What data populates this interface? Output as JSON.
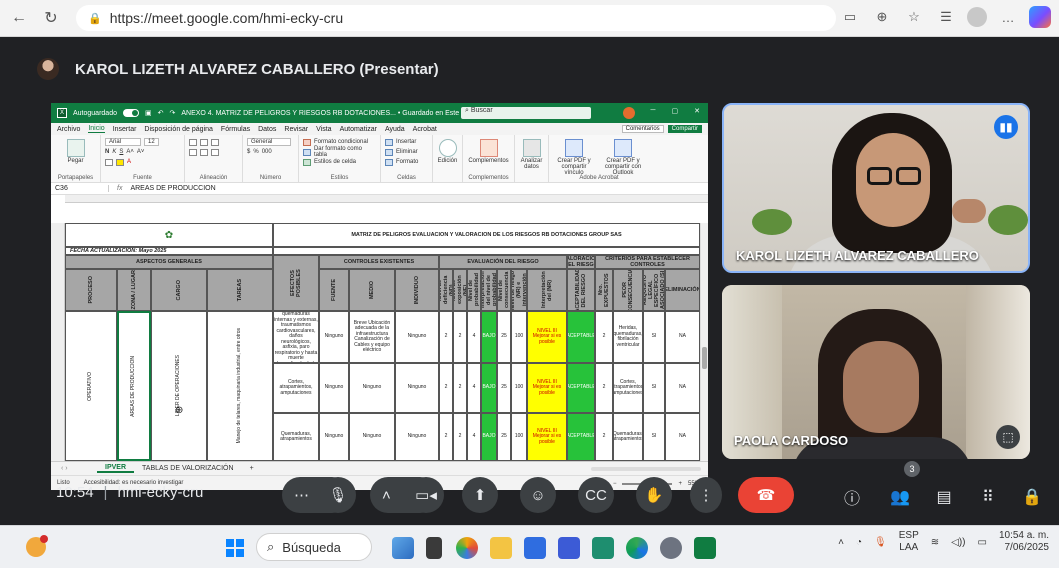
{
  "browser": {
    "url": "https://meet.google.com/hmi-ecky-cru",
    "icons": [
      "back-icon",
      "reload-icon",
      "lock-icon",
      "cast-icon",
      "zoom-icon",
      "favorite-icon",
      "collections-icon",
      "profile-icon",
      "more-icon",
      "copilot-icon"
    ]
  },
  "meet": {
    "presenter_label": "KAROL LIZETH ALVAREZ CABALLERO (Presentar)",
    "meeting_time": "10:54",
    "meeting_code": "hmi-ecky-cru",
    "participants_count": "3",
    "tiles": [
      {
        "name": "KAROL LIZETH ALVAREZ CABALLERO",
        "speaking": true
      },
      {
        "name": "PAOLA CARDOSO",
        "speaking": false
      }
    ],
    "controls": [
      "more-options",
      "microphone",
      "expand",
      "camera",
      "present",
      "emoji",
      "captions",
      "raise-hand",
      "more",
      "leave-call"
    ],
    "right_controls": [
      "info",
      "people",
      "chat",
      "activities",
      "host-controls"
    ],
    "colors": {
      "leave": "#ea4335",
      "control_bg": "#3c4043",
      "speaking_border": "#8ab4f8"
    }
  },
  "excel": {
    "autosave_label": "Autoguardado",
    "window_title": "ANEXO 4. MATRIZ DE PELIGROS Y RIESGOS RB DOTACIONES... • Guardado en Este PC ∨",
    "search_placeholder": "Buscar",
    "menu": [
      "Archivo",
      "Inicio",
      "Insertar",
      "Disposición de página",
      "Fórmulas",
      "Datos",
      "Revisar",
      "Vista",
      "Automatizar",
      "Ayuda",
      "Acrobat"
    ],
    "active_menu": "Inicio",
    "comments_label": "Comentarios",
    "share_label": "Compartir",
    "ribbon": {
      "paste": "Pegar",
      "portapapeles": "Portapapeles",
      "font_name": "Arial",
      "font_size": "12",
      "fuente": "Fuente",
      "alineacion": "Alineación",
      "number_format": "General",
      "numero": "Número",
      "cond_format": "Formato condicional",
      "table_format": "Dar formato como tabla",
      "cell_styles": "Estilos de celda",
      "estilos": "Estilos",
      "insert": "Insertar",
      "delete": "Eliminar",
      "format": "Formato",
      "celdas": "Celdas",
      "edicion": "Edición",
      "complementos": "Complementos",
      "complementos_group": "Complementos",
      "analizar": "Analizar datos",
      "pdf_link": "Crear PDF y compartir vínculo",
      "pdf_outlook": "Crear PDF y compartir con Outlook",
      "adobe": "Adobe Acrobat"
    },
    "name_box": "C36",
    "formula": "AREAS DE PRODUCCION",
    "sheet": {
      "matrix_title": "MATRIZ DE PELIGROS EVALUACION Y VALORACION DE LOS RIESGOS RB DOTACIONES GROUP SAS",
      "fecha": "FECHA ACTUALIZACIÓN: Mayo 2025",
      "aspectos": "ASPECTOS GENERALES",
      "controles": "CONTROLES EXISTENTES",
      "evaluacion": "EVALUACIÓN DEL RIESGO",
      "valoracion": "VALORACIÓN DEL RIESGO",
      "criterios": "CRITERIOS PARA ESTABLECER CONTROLES",
      "col_proceso": "PROCESO",
      "col_zona": "ZONA / LUGAR",
      "col_cargo": "CARGO",
      "col_tareas": "TAREAS",
      "col_efectos": "EFECTOS POSIBLES",
      "col_fuente": "FUENTE",
      "col_medio": "MEDIO",
      "col_individuo": "INDIVIDUO",
      "col_nd": "Nivel de deficiencia (ND)",
      "col_ne": "Nivel de exposición (NE)",
      "col_np": "Nivel de probabilidad",
      "col_interp_np": "Interpretación del nivel de probabilidad",
      "col_nc": "Nivel de consecuencia",
      "col_nr": "Nivel de riesgo (NR) e intervención",
      "col_interp_nr": "Interpretación del (NR)",
      "col_acept": "ACEPTABILIDAD DEL RIESGO",
      "col_expuestos": "Nro. EXPUESTOS",
      "col_peor": "PEOR CONSECUENCIA",
      "col_requisito": "EXISTENCIA REQUISITO LEGAL ESPECÍFICO ASOCIADO (SI o NO)",
      "col_eliminacion": "ELIMINACIÓN",
      "merged_proceso": "OPERATIVO",
      "merged_zona": "AREAS DE PRODUCCION",
      "merged_cargo": "LIDER DE OPERACIONES",
      "merged_tareas": "Manejo de telares, maquinaria industrial, entre otros",
      "rows": [
        {
          "efectos": "Contracciones musculares, quemaduras internas y externas, traumatismos cardiovasculares, daños neurológicos, asfixia, paro respiratorio y hasta muerte dependiendo de la intensidad",
          "fuente": "Ninguno",
          "medio": "Breve Ubicación adecuada de la infraestructura Canalización de Cables y equipo eléctrico",
          "individuo": "Ninguno",
          "nd": "2",
          "ne": "2",
          "np": "4",
          "interp_np": "BAJO",
          "nc": "25",
          "nr": "100",
          "interp_nr": "NIVEL III Mejorar si es posible",
          "acept": "ACEPTABLE",
          "expuestos": "2",
          "peor": "Heridas, quemaduras, fibrilación ventricular",
          "req": "SI",
          "elim": "NA"
        },
        {
          "efectos": "Cortes, atrapamientos, amputaciones",
          "fuente": "Ninguno",
          "medio": "Ninguno",
          "individuo": "Ninguno",
          "nd": "2",
          "ne": "2",
          "np": "4",
          "interp_np": "BAJO",
          "nc": "25",
          "nr": "100",
          "interp_nr": "NIVEL III Mejorar si es posible",
          "acept": "ACEPTABLE",
          "expuestos": "2",
          "peor": "Cortes, atrapamientos, amputaciones",
          "req": "SI",
          "elim": "NA"
        },
        {
          "efectos": "Quemaduras, atrapamientos",
          "fuente": "Ninguno",
          "medio": "Ninguno",
          "individuo": "Ninguno",
          "nd": "2",
          "ne": "2",
          "np": "4",
          "interp_np": "BAJO",
          "nc": "25",
          "nr": "100",
          "interp_nr": "NIVEL III Mejorar si es posible",
          "acept": "ACEPTABLE",
          "expuestos": "2",
          "peor": "Quemaduras, atrapamientos",
          "req": "SI",
          "elim": "NA"
        }
      ]
    },
    "tabs": [
      "IPVER",
      "TABLAS DE VALORIZACIÓN"
    ],
    "active_tab": "IPVER",
    "status_ready": "Listo",
    "status_accessibility": "Accesibilidad: es necesario investigar",
    "zoom": "55%"
  },
  "taskbar": {
    "search_placeholder": "Búsqueda",
    "lang": "ESP",
    "lang_sub": "LAA",
    "time": "10:54 a. m.",
    "date": "7/06/2025"
  }
}
